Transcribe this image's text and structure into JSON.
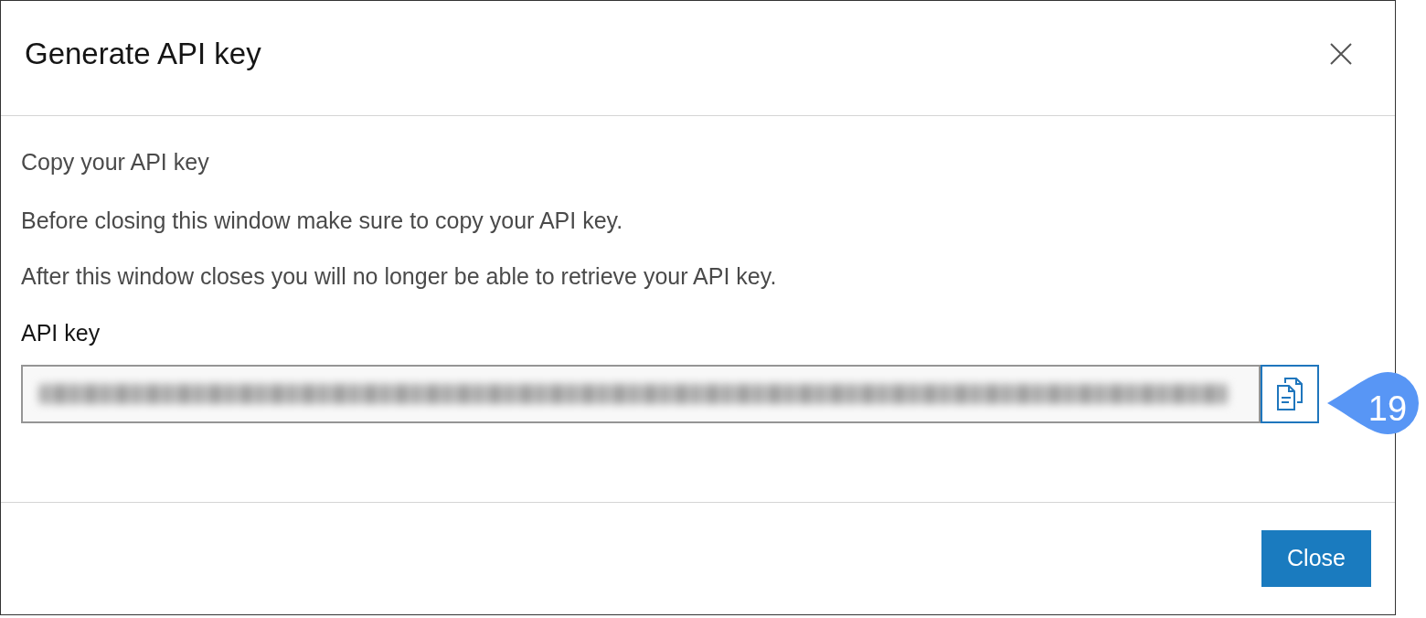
{
  "dialog": {
    "title": "Generate API key",
    "section_title": "Copy your API key",
    "messages": [
      "Before closing this window make sure to copy your API key.",
      "After this window closes you will no longer be able to retrieve your API key."
    ],
    "field_label": "API key",
    "buttons": [
      "Close"
    ]
  },
  "callout": {
    "number": "19"
  }
}
